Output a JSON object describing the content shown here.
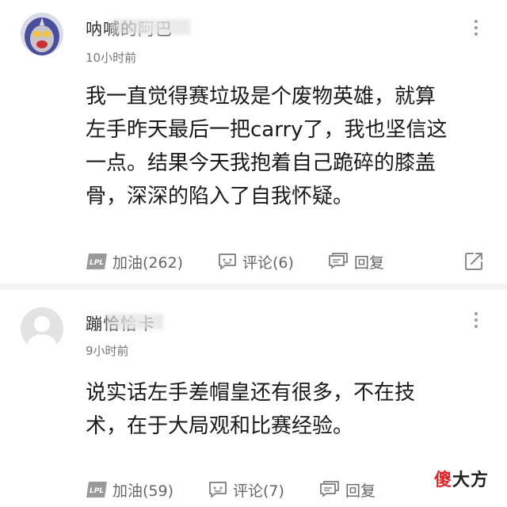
{
  "comments": [
    {
      "username": "呐喊的阿巴",
      "time": "10小时前",
      "lines": [
        "我一直觉得赛垃圾是个废物英雄，就算",
        "左手昨天最后一把carry了，我也坚信这",
        "一点。结果今天我抱着自己跪碎的膝盖",
        "骨，深深的陷入了自我怀疑。"
      ],
      "cheer_label": "加油(262)",
      "comment_label": "评论(6)",
      "reply_label": "回复"
    },
    {
      "username": "蹦恰恰卡",
      "time": "9小时前",
      "lines": [
        "说实话左手差帽皇还有很多，不在技",
        "术，在于大局观和比赛经验。"
      ],
      "cheer_label": "加油(59)",
      "comment_label": "评论(7)",
      "reply_label": "回复"
    }
  ],
  "badge": "LPL",
  "watermark": {
    "red_char": "傻",
    "rest": "大方"
  },
  "colors": {
    "text": "#1a1a1a",
    "muted": "#777777",
    "divider": "#f3f3f3",
    "watermark_red": "#e0242a"
  },
  "icons": [
    "more-vertical-icon",
    "lpl-badge-icon",
    "comment-bubble-icon",
    "reply-bubble-icon",
    "share-icon"
  ]
}
